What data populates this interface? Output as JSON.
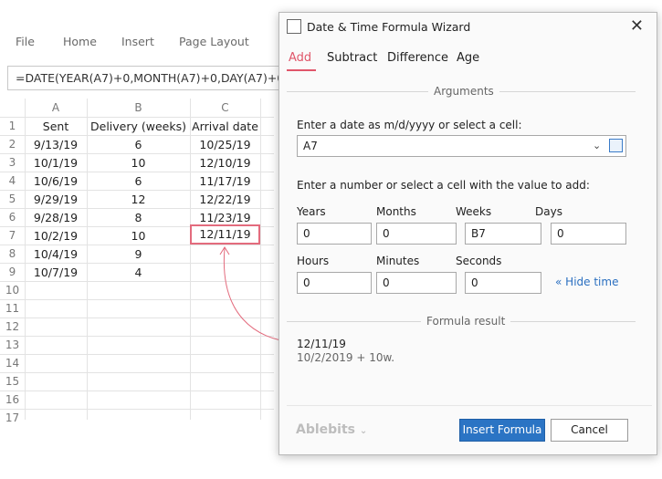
{
  "ribbon": {
    "tabs": [
      "File",
      "Home",
      "Insert",
      "Page Layout"
    ]
  },
  "formula_bar": {
    "value": "=DATE(YEAR(A7)+0,MONTH(A7)+0,DAY(A7)+0+E"
  },
  "sheet": {
    "columns": [
      "A",
      "B",
      "C"
    ],
    "rows": [
      "1",
      "2",
      "3",
      "4",
      "5",
      "6",
      "7",
      "8",
      "9",
      "10",
      "11",
      "12",
      "13",
      "14",
      "15",
      "16",
      "17"
    ],
    "headers": [
      "Sent",
      "Delivery  (weeks)",
      "Arrival date"
    ],
    "data": [
      [
        "9/13/19",
        "6",
        "10/25/19"
      ],
      [
        "10/1/19",
        "10",
        "12/10/19"
      ],
      [
        "10/6/19",
        "6",
        "11/17/19"
      ],
      [
        "9/29/19",
        "12",
        "12/22/19"
      ],
      [
        "9/28/19",
        "8",
        "11/23/19"
      ],
      [
        "10/2/19",
        "10",
        "12/11/19"
      ],
      [
        "10/4/19",
        "9",
        ""
      ],
      [
        "10/7/19",
        "4",
        ""
      ]
    ]
  },
  "dialog": {
    "title": "Date & Time Formula Wizard",
    "tabs": [
      "Add",
      "Subtract",
      "Difference",
      "Age"
    ],
    "arguments_title": "Arguments",
    "date_label": "Enter a date as m/d/yyyy or select a cell:",
    "date_value": "A7",
    "number_label": "Enter a number or select a cell with the value to add:",
    "fields": {
      "years": {
        "label": "Years",
        "value": "0"
      },
      "months": {
        "label": "Months",
        "value": "0"
      },
      "weeks": {
        "label": "Weeks",
        "value": "B7"
      },
      "days": {
        "label": "Days",
        "value": "0"
      },
      "hours": {
        "label": "Hours",
        "value": "0"
      },
      "minutes": {
        "label": "Minutes",
        "value": "0"
      },
      "seconds": {
        "label": "Seconds",
        "value": "0"
      }
    },
    "hide_time": "Hide time",
    "formula_result_title": "Formula result",
    "result_value": "12/11/19",
    "result_detail": "10/2/2019 + 10w.",
    "brand": "Ablebits",
    "insert_button": "Insert Formula",
    "cancel_button": "Cancel"
  },
  "colors": {
    "accent": "#e0566a",
    "primary": "#2b74c4"
  }
}
